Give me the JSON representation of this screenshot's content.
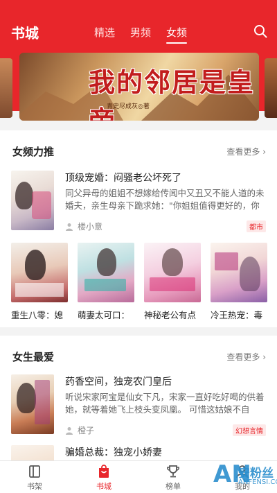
{
  "header": {
    "title": "书城",
    "tabs": [
      {
        "label": "精选",
        "active": false
      },
      {
        "label": "男频",
        "active": false
      },
      {
        "label": "女频",
        "active": true
      }
    ],
    "search_icon": "search-icon"
  },
  "banner": {
    "title": "我的邻居是皇帝",
    "author": "青史尽成灰◎著"
  },
  "section_female_push": {
    "title": "女频力推",
    "more": "查看更多",
    "featured": {
      "title": "顶级宠婚：闷骚老公坏死了",
      "desc": "同父异母的姐姐不想嫁给传闻中又丑又不能人道的未婚夫，亲生母亲下跪求她：\"你姐姐值得更好的，你",
      "author": "楼小意",
      "tag": "都市"
    },
    "books": [
      {
        "name": "重生八零：媳"
      },
      {
        "name": "萌妻太可口："
      },
      {
        "name": "神秘老公有点"
      },
      {
        "name": "冷王热宠：毒"
      }
    ]
  },
  "section_girls_love": {
    "title": "女生最爱",
    "more": "查看更多",
    "featured": {
      "title": "药香空间，独宠农门皇后",
      "desc": "听说宋家阿宝是仙女下凡，宋家一直好吃好喝的供着她，就等着她飞上枝头变凤凰。 可惜这姑娘不自",
      "author": "橙子",
      "tag": "幻想言情"
    },
    "next": {
      "title": "骗婚总裁：独宠小娇妻"
    }
  },
  "bottom_nav": [
    {
      "label": "书架",
      "active": false
    },
    {
      "label": "书城",
      "active": true
    },
    {
      "label": "榜单",
      "active": false
    },
    {
      "label": "我的",
      "active": false
    }
  ],
  "watermark": {
    "big": "AN",
    "cn": "安粉丝",
    "url": "ANFENSI.COM"
  },
  "colors": {
    "accent": "#e8262b",
    "tag_bg": "#fde8e8"
  }
}
